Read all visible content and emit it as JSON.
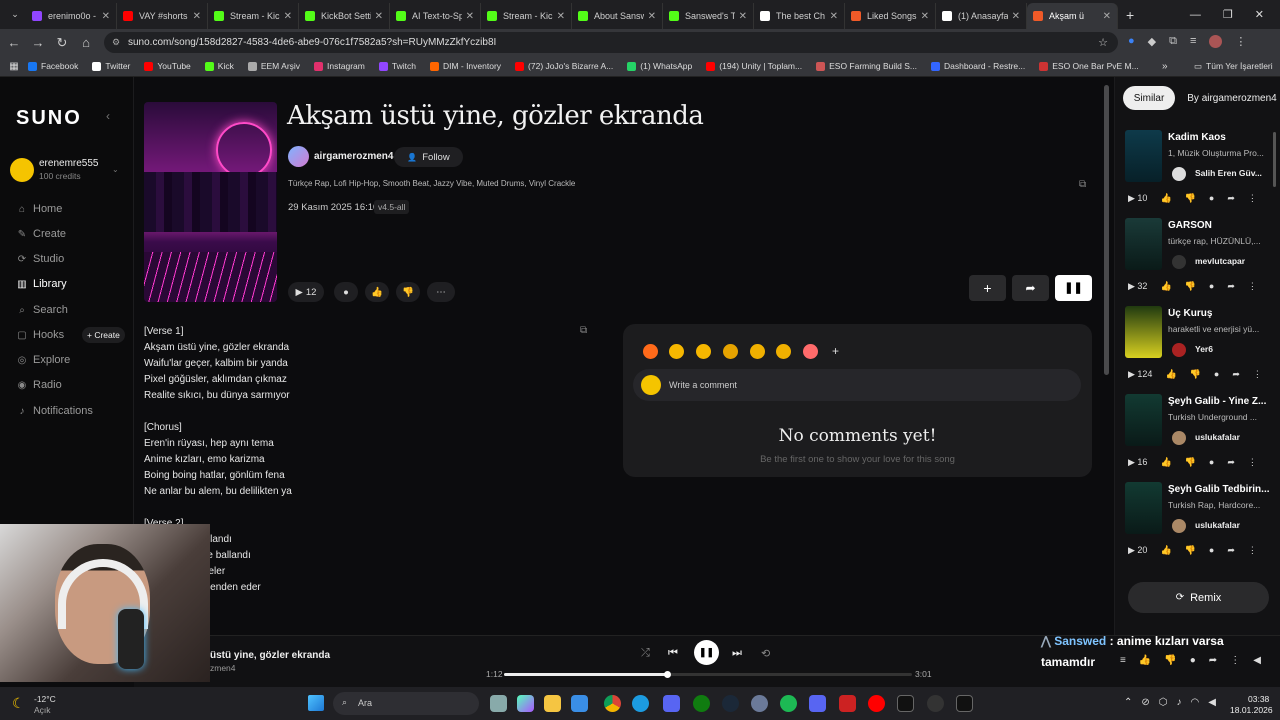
{
  "tabs": [
    {
      "label": "erenimo0o -",
      "color": "#9146ff"
    },
    {
      "label": "VAY #shorts",
      "color": "#ff0000"
    },
    {
      "label": "Stream - Kic",
      "color": "#53fc18"
    },
    {
      "label": "KickBot Setti",
      "color": "#53fc18"
    },
    {
      "label": "AI Text-to-Sp",
      "color": "#53fc18"
    },
    {
      "label": "Stream - Kic",
      "color": "#53fc18"
    },
    {
      "label": "About Sansw",
      "color": "#53fc18"
    },
    {
      "label": "Sanswed's T",
      "color": "#53fc18"
    },
    {
      "label": "The best Ch",
      "color": "#ffffff"
    },
    {
      "label": "Liked Songs",
      "color": "#f05a28"
    },
    {
      "label": "(1) Anasayfa",
      "color": "#ffffff"
    },
    {
      "label": "Akşam ü",
      "color": "#f05a28"
    }
  ],
  "url": "suno.com/song/158d2827-4583-4de6-abe9-076c1f7582a5?sh=RUyMMzZkfYczib8I",
  "bookmarks": [
    "Facebook",
    "Twitter",
    "YouTube",
    "Kick",
    "EEM Arşiv",
    "Instagram",
    "Twitch",
    "DIM - Inventory",
    "(72) JoJo's Bizarre A...",
    "(1) WhatsApp",
    "(194) Unity | Toplam...",
    "ESO Farming Build S...",
    "Dashboard - Restre...",
    "ESO One Bar PvE M..."
  ],
  "bookmarks_folder": "Tüm Yer İşaretleri",
  "sidebar": {
    "logo": "SUNO",
    "user": "erenemre555",
    "credits": "100 credits",
    "nav": [
      "Home",
      "Create",
      "Studio",
      "Library",
      "Search",
      "Hooks",
      "Explore",
      "Radio",
      "Notifications"
    ],
    "hooks_create": "+ Create"
  },
  "song": {
    "title": "Akşam üstü yine, gözler ekranda",
    "artist": "airgamerozmen4",
    "follow": "Follow",
    "tags": "Türkçe Rap, Lofi Hip-Hop, Smooth Beat, Jazzy Vibe, Muted Drums, Vinyl Crackle",
    "date": "29 Kasım 2025 16:10",
    "version": "v4.5-all",
    "plays": "12"
  },
  "lyrics": "[Verse 1]\nAkşam üstü yine, gözler ekranda\nWaifu'lar geçer, kalbim bir yanda\nPixel göğüsler, aklımdan çıkmaz\nRealite sıkıcı, bu dünya sarmıyor\n\n[Chorus]\nEren'in rüyası, hep aynı tema\nAnime kızları, emo karizma\nBoing boing hatlar, gönlüm fena\nNe anlar bu alem, bu delilikten ya\n\n[Verse 2]\n           ayfa toplandı\n           di, oh ne ballandı\n           siyah ojeler\n           r, beni benden eder",
  "comments": {
    "placeholder": "Write a comment",
    "empty_title": "No comments yet!",
    "empty_sub": "Be the first one to show your love for this song"
  },
  "right": {
    "tab_similar": "Similar",
    "tab_by": "By airgamerozmen4",
    "cards": [
      {
        "title": "Kadim Kaos",
        "sub": "1, Müzik Oluşturma Pro...",
        "user": "Salih Eren Güv...",
        "plays": "10"
      },
      {
        "title": "GARSON",
        "sub": "türkçe rap, HÜZÜNLÜ,...",
        "user": "mevlutcapar",
        "plays": "32"
      },
      {
        "title": "Üç Kuruş",
        "sub": "haraketli ve enerjisi yü...",
        "user": "Yer6",
        "plays": "124"
      },
      {
        "title": "Şeyh Galib - Yine Z...",
        "sub": "Turkish Underground ...",
        "user": "uslukafalar",
        "plays": "16"
      },
      {
        "title": "Şeyh Galib Tedbirin...",
        "sub": "Turkish Rap, Hardcore...",
        "user": "uslukafalar",
        "plays": "20"
      }
    ],
    "remix": "Remix"
  },
  "player": {
    "title": "üstü yine, gözler ekranda",
    "artist": "zmen4",
    "elapsed": "1:12",
    "total": "3:01",
    "progress": 0.4
  },
  "chat": {
    "user": "Sanswed",
    "text": ": anime kızları varsa tamamdır"
  },
  "taskbar": {
    "weather_temp": "-12°C",
    "weather_desc": "Açık",
    "search": "Ara",
    "time": "03:38",
    "date": "18.01.2026"
  }
}
